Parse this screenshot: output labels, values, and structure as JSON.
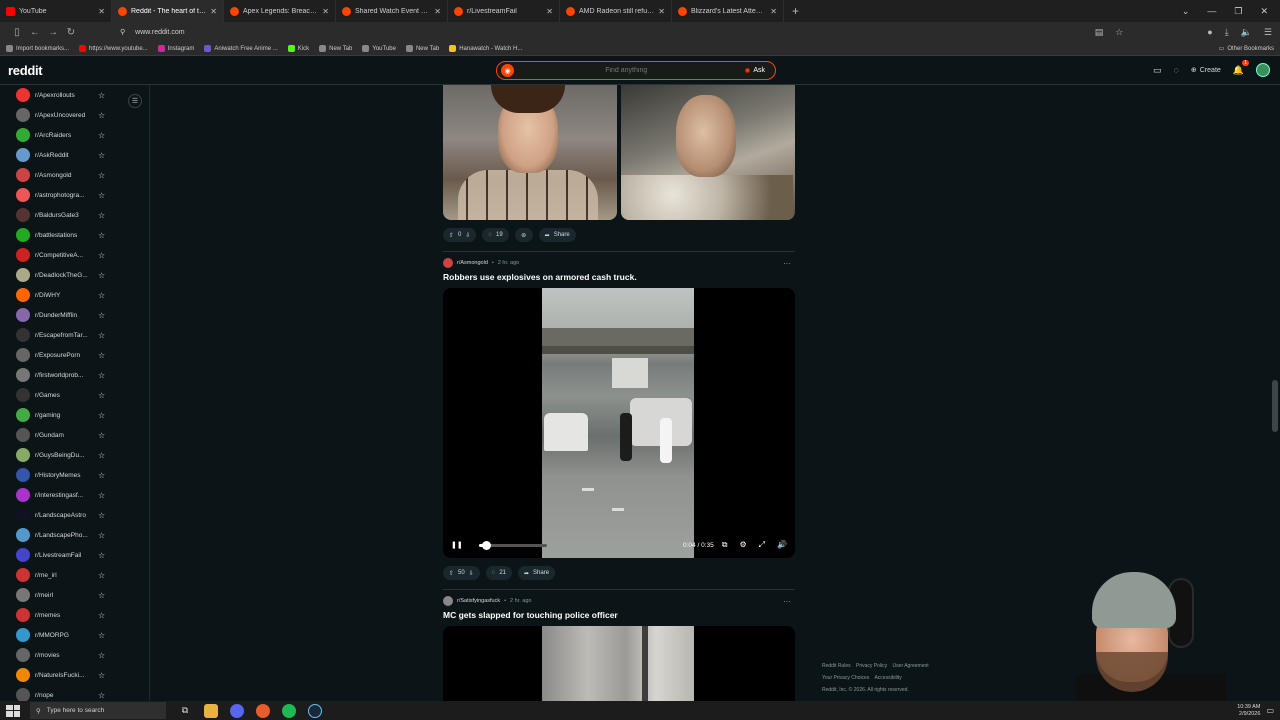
{
  "browser": {
    "tabs": [
      {
        "title": "YouTube",
        "type": "yt",
        "active": false
      },
      {
        "title": "Reddit - The heart of the internet",
        "type": "reddit",
        "active": true
      },
      {
        "title": "Apex Legends: Breach Patch Notes",
        "type": "reddit",
        "active": false
      },
      {
        "title": "Shared Watch Event Begins Tomorrow",
        "type": "reddit",
        "active": false
      },
      {
        "title": "r/LivestreamFail",
        "type": "reddit",
        "active": false
      },
      {
        "title": "AMD Radeon still refuses to die",
        "type": "reddit",
        "active": false
      },
      {
        "title": "Blizzard's Latest Attempt at a St",
        "type": "reddit",
        "active": false
      }
    ],
    "new_tab": "+",
    "url": "www.reddit.com",
    "bookmarks": [
      {
        "label": "Import bookmarks...",
        "color": "#888"
      },
      {
        "label": "https://www.youtube...",
        "color": "#ff0000"
      },
      {
        "label": "Instagram",
        "color": "#d6249f"
      },
      {
        "label": "Aniwatch Free Anime ...",
        "color": "#6a5acd"
      },
      {
        "label": "Kick",
        "color": "#53fc18"
      },
      {
        "label": "New Tab",
        "color": "#888"
      },
      {
        "label": "YouTube",
        "color": "#888"
      },
      {
        "label": "New Tab",
        "color": "#888"
      },
      {
        "label": "Hanawatch - Watch H...",
        "color": "#f0c419"
      }
    ],
    "other_bookmarks": "Other Bookmarks"
  },
  "header": {
    "logo": "reddit",
    "search_placeholder": "Find anything",
    "ask_label": "Ask",
    "create_label": "Create",
    "notif_count": "1"
  },
  "sidebar": {
    "items": [
      {
        "label": "r/Apexrollouts",
        "color": "#e33"
      },
      {
        "label": "r/ApexUncovered",
        "color": "#666"
      },
      {
        "label": "r/ArcRaiders",
        "color": "#3a3"
      },
      {
        "label": "r/AskReddit",
        "color": "#69c"
      },
      {
        "label": "r/Asmongold",
        "color": "#c44"
      },
      {
        "label": "r/astrophotogra...",
        "color": "#e55"
      },
      {
        "label": "r/BaldursGate3",
        "color": "#533"
      },
      {
        "label": "r/battlestations",
        "color": "#2a2"
      },
      {
        "label": "r/CompetitiveA...",
        "color": "#c22"
      },
      {
        "label": "r/DeadlockTheG...",
        "color": "#aa8"
      },
      {
        "label": "r/DiWHY",
        "color": "#f60"
      },
      {
        "label": "r/DunderMifflin",
        "color": "#86a"
      },
      {
        "label": "r/EscapefromTar...",
        "color": "#333"
      },
      {
        "label": "r/ExposurePorn",
        "color": "#666"
      },
      {
        "label": "r/firstworldprob...",
        "color": "#777"
      },
      {
        "label": "r/Games",
        "color": "#333"
      },
      {
        "label": "r/gaming",
        "color": "#4a4"
      },
      {
        "label": "r/Gundam",
        "color": "#555"
      },
      {
        "label": "r/GuysBeingDu...",
        "color": "#8a6"
      },
      {
        "label": "r/HistoryMemes",
        "color": "#35a"
      },
      {
        "label": "r/interestingasf...",
        "color": "#a3c"
      },
      {
        "label": "r/LandscapeAstro",
        "color": "#112"
      },
      {
        "label": "r/LandscapePho...",
        "color": "#59c"
      },
      {
        "label": "r/LivestreamFail",
        "color": "#44c"
      },
      {
        "label": "r/me_irl",
        "color": "#c33"
      },
      {
        "label": "r/meirl",
        "color": "#777"
      },
      {
        "label": "r/memes",
        "color": "#c33"
      },
      {
        "label": "r/MMORPG",
        "color": "#39c"
      },
      {
        "label": "r/movies",
        "color": "#666"
      },
      {
        "label": "r/NatureIsFucki...",
        "color": "#e80"
      },
      {
        "label": "r/nope",
        "color": "#555"
      }
    ]
  },
  "feed": {
    "post1": {
      "votes": "0",
      "comments": "19",
      "share": "Share"
    },
    "post2": {
      "subreddit": "r/Asmongold",
      "time": "2 hr. ago",
      "title": "Robbers use explosives on armored cash truck.",
      "video_time": "0:04 / 0:35",
      "progress": 0.11,
      "votes": "50",
      "comments": "21",
      "share": "Share"
    },
    "post3": {
      "subreddit": "r/Satisfyingasfuck",
      "time": "2 hr. ago",
      "title": "MC gets slapped for touching police officer"
    }
  },
  "footer": {
    "links": [
      "Reddit Rules",
      "Privacy Policy",
      "User Agreement",
      "Your Privacy Choices",
      "Accessibility"
    ],
    "copyright": "Reddit, Inc. © 2026. All rights reserved."
  },
  "taskbar": {
    "search_placeholder": "Type here to search",
    "time": "10:39 AM",
    "date": "2/9/2026"
  }
}
